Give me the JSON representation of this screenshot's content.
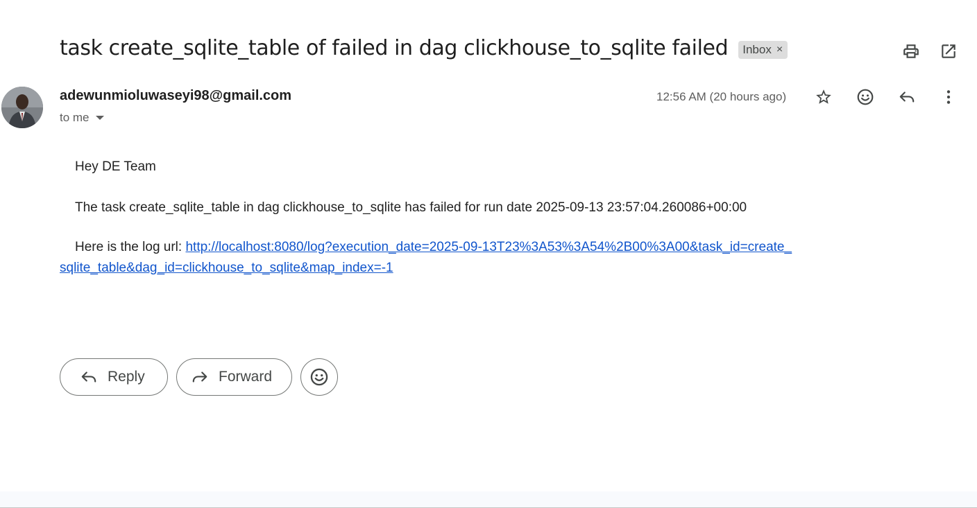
{
  "subject": "task create_sqlite_table of failed in dag clickhouse_to_sqlite failed",
  "label_chip": {
    "text": "Inbox",
    "close": "×"
  },
  "sender": {
    "email": "adewunmioluwaseyi98@gmail.com",
    "recipient": "to me",
    "timestamp": "12:56 AM (20 hours ago)"
  },
  "body": {
    "greeting": "Hey DE Team",
    "message": "The task create_sqlite_table in dag clickhouse_to_sqlite has failed for run date 2025-09-13 23:57:04.260086+00:00",
    "log_prefix": "Here is the log url: ",
    "log_url_part1": "http://localhost:8080/log?execution_date=2025-09-13T23%3A53%3A54%2B00%3A00&task_id=create_",
    "log_url_part2": "sqlite_table&dag_id=clickhouse_to_sqlite&map_index=-1",
    "log_url": "http://localhost:8080/log?execution_date=2025-09-13T23%3A53%3A54%2B00%3A00&task_id=create_sqlite_table&dag_id=clickhouse_to_sqlite&map_index=-1"
  },
  "actions": {
    "reply": "Reply",
    "forward": "Forward"
  },
  "icons": {
    "print": "printer-icon",
    "open_new_window": "open-in-new-icon",
    "star": "star-icon",
    "emoji": "emoji-icon",
    "reply": "reply-icon",
    "more": "more-vert-icon"
  }
}
